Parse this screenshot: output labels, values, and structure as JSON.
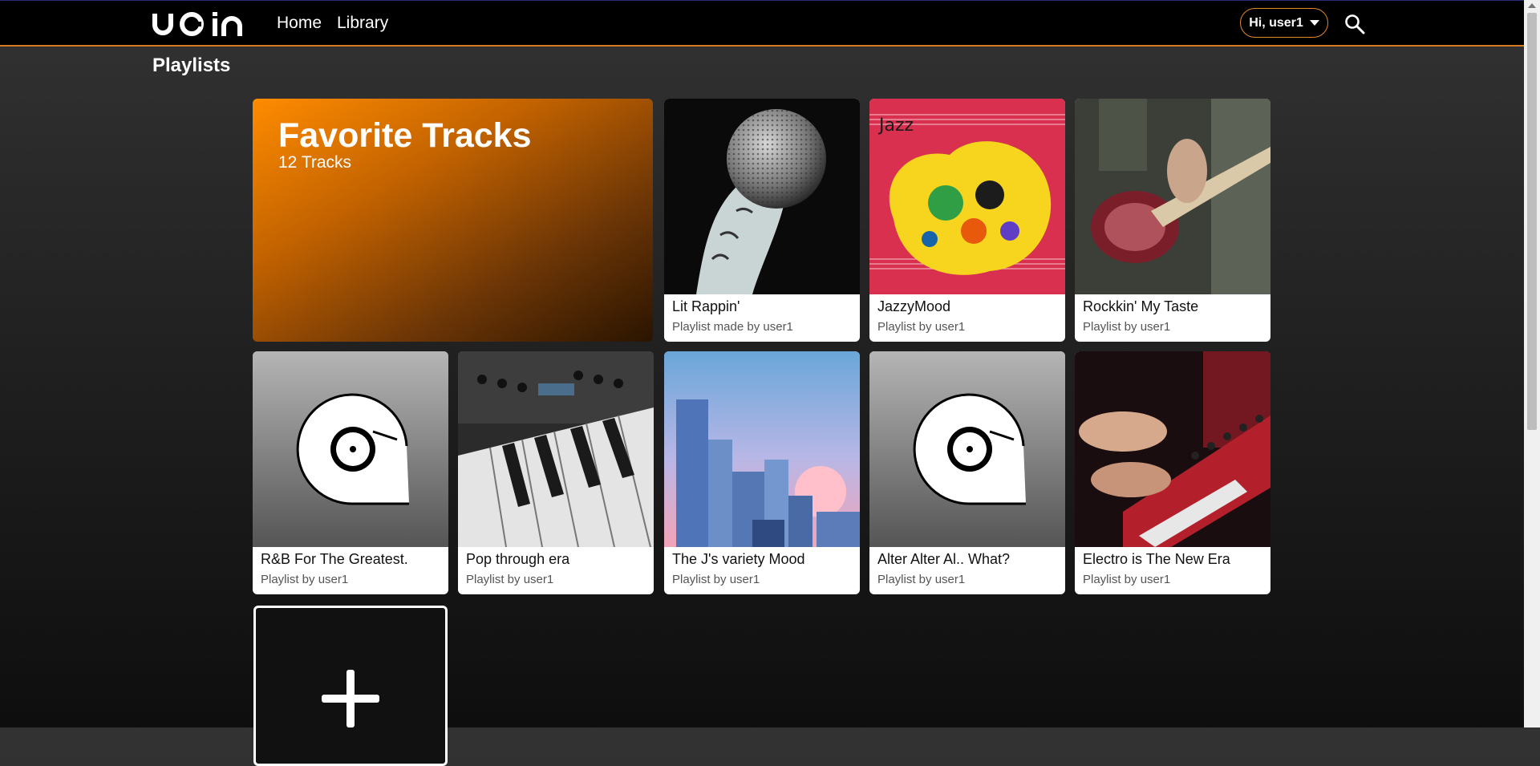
{
  "header": {
    "logo_text": "ueín",
    "nav": [
      {
        "label": "Home"
      },
      {
        "label": "Library"
      }
    ],
    "user_menu_label": "Hi, user1",
    "icons": {
      "search": "search-icon",
      "caret": "chevron-down-icon"
    }
  },
  "page": {
    "title": "Playlists"
  },
  "favorite": {
    "title": "Favorite Tracks",
    "count": "12 Tracks"
  },
  "playlists": [
    {
      "name": "Lit Rappin'",
      "subtitle": "Playlist made by user1"
    },
    {
      "name": "JazzyMood",
      "subtitle": "Playlist by user1"
    },
    {
      "name": "Rockkin' My Taste",
      "subtitle": "Playlist by user1"
    },
    {
      "name": "R&B For The Greatest.",
      "subtitle": "Playlist by user1"
    },
    {
      "name": "Pop through era",
      "subtitle": "Playlist by user1"
    },
    {
      "name": "The J's variety Mood",
      "subtitle": "Playlist by user1"
    },
    {
      "name": "Alter Alter Al.. What?",
      "subtitle": "Playlist by user1"
    },
    {
      "name": "Electro is The New Era",
      "subtitle": "Playlist by user1"
    }
  ],
  "colors": {
    "accent": "#e38a2a",
    "background": "#2a2a2a",
    "card": "#ffffff"
  }
}
